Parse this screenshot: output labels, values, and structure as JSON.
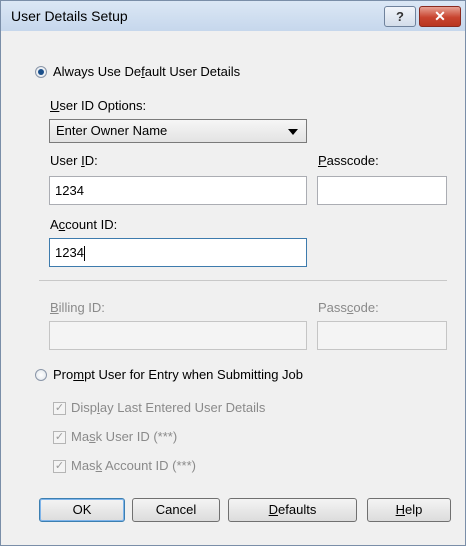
{
  "dialog": {
    "title": "User Details Setup",
    "help_button": "?",
    "close_button": "✕"
  },
  "always_use_default": {
    "label_pre": "Always Use De",
    "label_mn": "f",
    "label_post": "ault User Details",
    "checked": true
  },
  "user_id_options": {
    "label_mn": "U",
    "label_post": "ser ID Options:",
    "selected": "Enter Owner Name"
  },
  "user_id": {
    "label_pre": "User ",
    "label_mn": "I",
    "label_post": "D:",
    "value": "1234"
  },
  "passcode": {
    "label_mn": "P",
    "label_post": "asscode:",
    "value": ""
  },
  "account_id": {
    "label_pre": "A",
    "label_mn": "c",
    "label_post": "count ID:",
    "value": "1234"
  },
  "billing_id": {
    "label_mn": "B",
    "label_post": "illing ID:",
    "value": ""
  },
  "billing_passcode": {
    "label_pre": "Pass",
    "label_mn": "c",
    "label_post": "ode:",
    "value": ""
  },
  "prompt_user": {
    "label_pre": "Pro",
    "label_mn": "m",
    "label_post": "pt User for Entry when Submitting Job",
    "checked": false
  },
  "checkboxes": {
    "display_last": {
      "label_pre": "Disp",
      "label_mn": "l",
      "label_post": "ay Last Entered User Details",
      "checked": true
    },
    "mask_user": {
      "label_pre": "Ma",
      "label_mn": "s",
      "label_post": "k User ID (***)",
      "checked": true
    },
    "mask_account": {
      "label_pre": "Mas",
      "label_mn": "k",
      "label_post": " Account ID (***)",
      "checked": true
    }
  },
  "buttons": {
    "ok": "OK",
    "cancel": "Cancel",
    "defaults_mn": "D",
    "defaults_post": "efaults",
    "help_mn": "H",
    "help_post": "elp"
  }
}
